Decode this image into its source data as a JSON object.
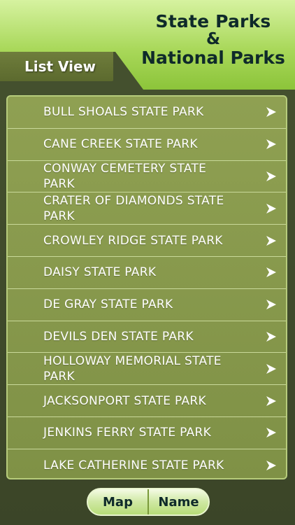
{
  "header": {
    "title_line1": "State Parks",
    "title_amp": "&",
    "title_line2": "National Parks",
    "tab_label": "List View"
  },
  "list": {
    "items": [
      "BULL SHOALS STATE PARK",
      "CANE CREEK STATE PARK",
      "CONWAY CEMETERY STATE PARK",
      "CRATER OF DIAMONDS STATE PARK",
      "CROWLEY RIDGE STATE PARK",
      "DAISY STATE PARK",
      "DE GRAY STATE PARK",
      "DEVILS DEN STATE PARK",
      "HOLLOWAY MEMORIAL STATE PARK",
      "JACKSONPORT STATE PARK",
      "JENKINS FERRY STATE PARK",
      "LAKE CATHERINE STATE PARK"
    ],
    "arrow_icon": "chevron-right-icon"
  },
  "toggle": {
    "map_label": "Map",
    "name_label": "Name"
  },
  "colors": {
    "header_green": "#a9d85a",
    "tab_olive": "#5c6a2e",
    "list_bg": "#8fa052",
    "title_text": "#0f2a2a"
  }
}
